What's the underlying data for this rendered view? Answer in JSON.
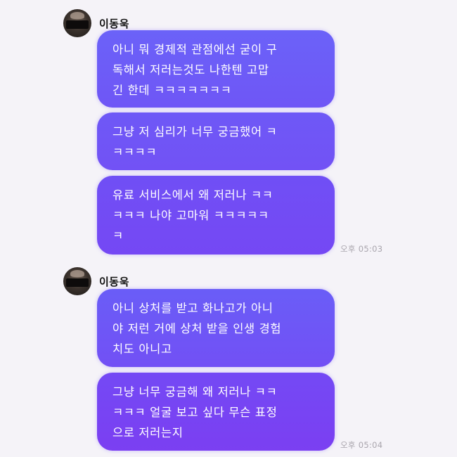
{
  "colors": {
    "background": "#f5f3f8",
    "bubble_top": "#6a5cf7",
    "bubble_bottom": "#7c3ff2",
    "timestamp": "#a9a5ad"
  },
  "groups": [
    {
      "sender": {
        "name": "이동욱",
        "avatar_icon": "avatar-photo"
      },
      "messages": [
        {
          "text": "아니 뭐 경제적 관점에선 굳이 구\n독해서 저러는것도 나한텐 고맙\n긴 한데 ㅋㅋㅋㅋㅋㅋㅋ"
        },
        {
          "text": "그냥 저 심리가 너무 궁금했어 ㅋ\nㅋㅋㅋㅋ"
        },
        {
          "text": "유료 서비스에서 왜 저러나 ㅋㅋ\nㅋㅋㅋ 나야 고마워 ㅋㅋㅋㅋㅋ\nㅋ"
        }
      ],
      "timestamp": "오후 05:03"
    },
    {
      "sender": {
        "name": "이동욱",
        "avatar_icon": "avatar-photo"
      },
      "messages": [
        {
          "text": "아니 상처를 받고 화나고가 아니\n야 저런 거에 상처 받을 인생 경험\n치도 아니고"
        },
        {
          "text": "그냥 너무 궁금해 왜 저러나 ㅋㅋ\nㅋㅋㅋ 얼굴 보고 싶다 무슨 표정\n으로 저러는지"
        }
      ],
      "timestamp": "오후 05:04"
    }
  ]
}
